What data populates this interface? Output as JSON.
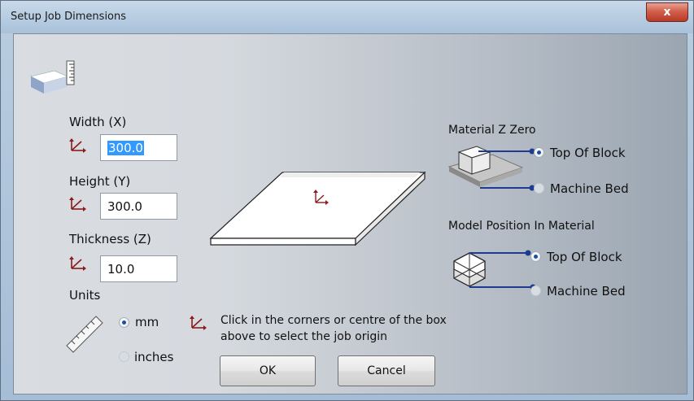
{
  "window": {
    "title": "Setup Job Dimensions",
    "close_label": "x"
  },
  "dimensions": {
    "width_label": "Width (X)",
    "width_value": "300.0",
    "height_label": "Height (Y)",
    "height_value": "300.0",
    "thickness_label": "Thickness (Z)",
    "thickness_value": "10.0"
  },
  "units": {
    "label": "Units",
    "options": [
      {
        "label": "mm",
        "selected": true
      },
      {
        "label": "inches",
        "selected": false
      }
    ]
  },
  "material_z_zero": {
    "title": "Material Z Zero",
    "options": [
      {
        "label": "Top Of Block",
        "selected": true
      },
      {
        "label": "Machine Bed",
        "selected": false
      }
    ]
  },
  "model_position": {
    "title": "Model Position In Material",
    "options": [
      {
        "label": "Top Of Block",
        "selected": true
      },
      {
        "label": "Machine Bed",
        "selected": false
      }
    ]
  },
  "hint": {
    "line1": "Click in the corners or centre of the box",
    "line2": "above to select the job origin"
  },
  "buttons": {
    "ok": "OK",
    "cancel": "Cancel"
  },
  "icons": [
    "job-block-icon",
    "origin-axes-icon",
    "ruler-icon",
    "material-block-icon",
    "model-cube-icon"
  ],
  "colors": {
    "accent": "#1f3a8f",
    "selection": "#3399ff",
    "axis_red": "#8b1a1a",
    "close_red": "#c94a35"
  }
}
